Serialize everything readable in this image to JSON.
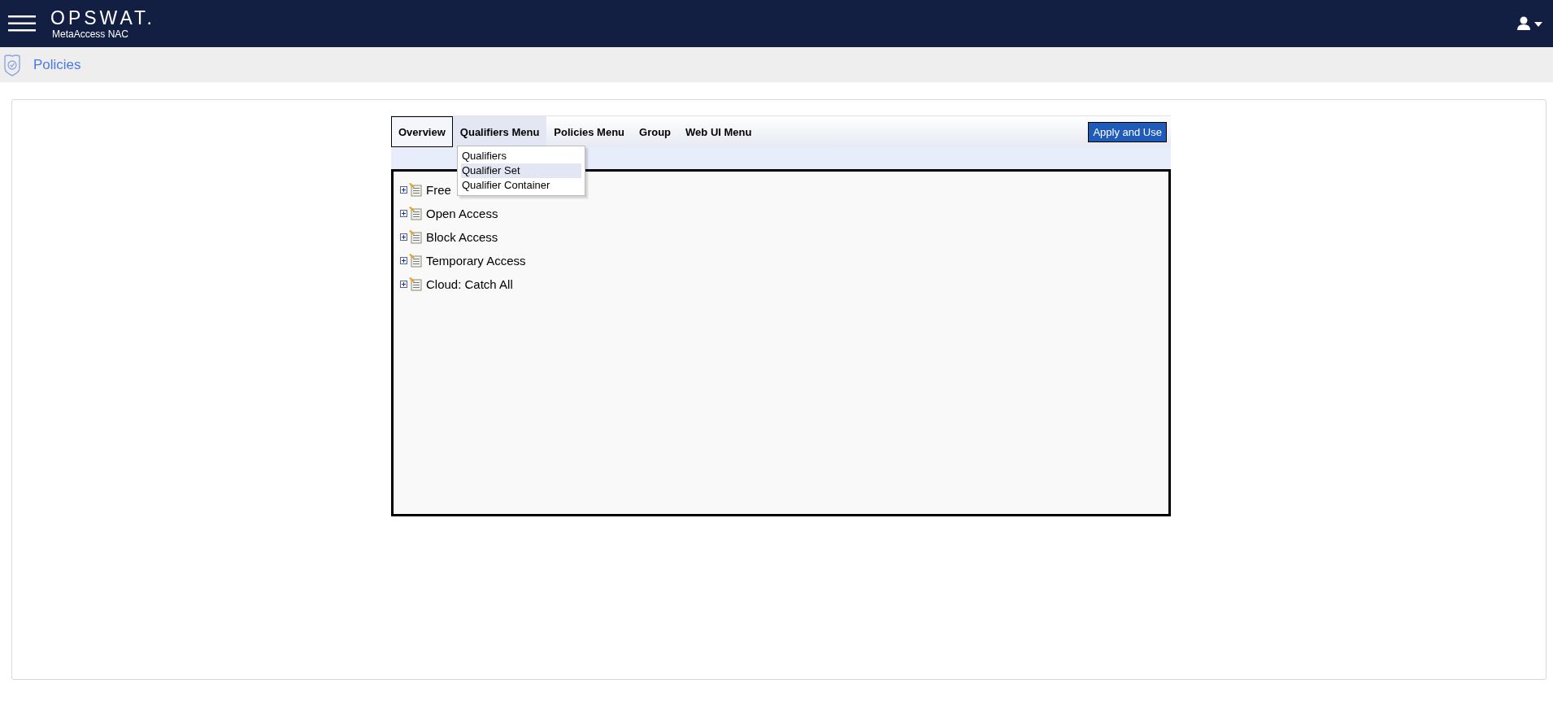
{
  "header": {
    "logo": "OPSWAT.",
    "product": "MetaAccess NAC"
  },
  "breadcrumb": {
    "title": "Policies"
  },
  "tabs": [
    {
      "label": "Overview",
      "selected": true,
      "open": false
    },
    {
      "label": "Qualifiers Menu",
      "selected": false,
      "open": true
    },
    {
      "label": "Policies Menu",
      "selected": false,
      "open": false
    },
    {
      "label": "Group",
      "selected": false,
      "open": false
    },
    {
      "label": "Web UI Menu",
      "selected": false,
      "open": false
    }
  ],
  "apply_button": "Apply and Use",
  "dropdown": [
    {
      "label": "Qualifiers",
      "selected": false
    },
    {
      "label": "Qualifier Set",
      "selected": true
    },
    {
      "label": "Qualifier Container",
      "selected": false
    }
  ],
  "tree": [
    {
      "label": "Free",
      "expanded": false
    },
    {
      "label": "Open Access",
      "expanded": false
    },
    {
      "label": "Block Access",
      "expanded": false
    },
    {
      "label": "Temporary Access",
      "expanded": false
    },
    {
      "label": "Cloud: Catch All",
      "expanded": false
    }
  ]
}
